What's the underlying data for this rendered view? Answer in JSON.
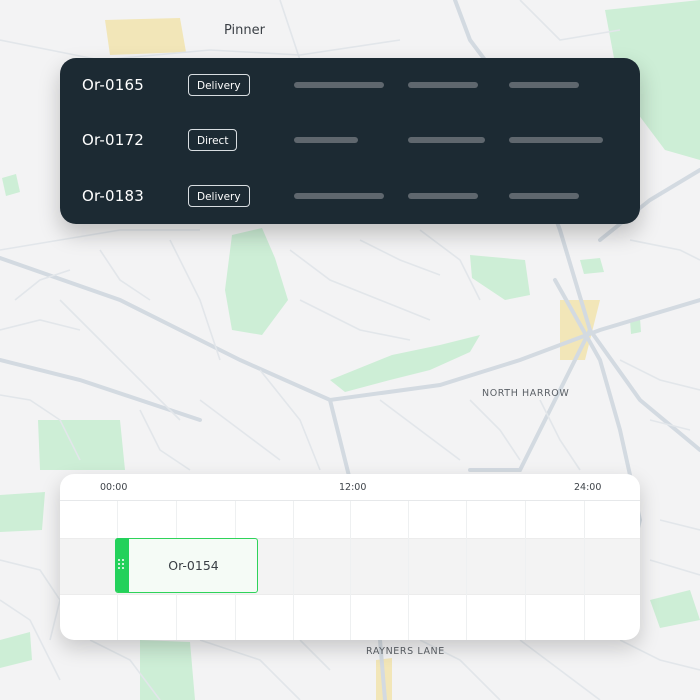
{
  "map": {
    "labels": {
      "pinner": "Pinner",
      "north_harrow": "NORTH HARROW",
      "rayners_lane": "RAYNERS LANE"
    },
    "colors": {
      "background": "#f3f3f4",
      "park": "#cdeed6",
      "road": "#d6dde3",
      "major_road": "#c9d3dc",
      "highlight": "#f2e6b8"
    }
  },
  "orders": {
    "rows": [
      {
        "id": "Or-0165",
        "type": "Delivery"
      },
      {
        "id": "Or-0172",
        "type": "Direct"
      },
      {
        "id": "Or-0183",
        "type": "Delivery"
      }
    ],
    "colors": {
      "card": "#1c2a33",
      "placeholder": "#5f676e"
    }
  },
  "timeline": {
    "ticks": [
      "00:00",
      "12:00",
      "24:00"
    ],
    "block": {
      "label": "Or-0154"
    },
    "colors": {
      "accent": "#23d15b"
    }
  }
}
